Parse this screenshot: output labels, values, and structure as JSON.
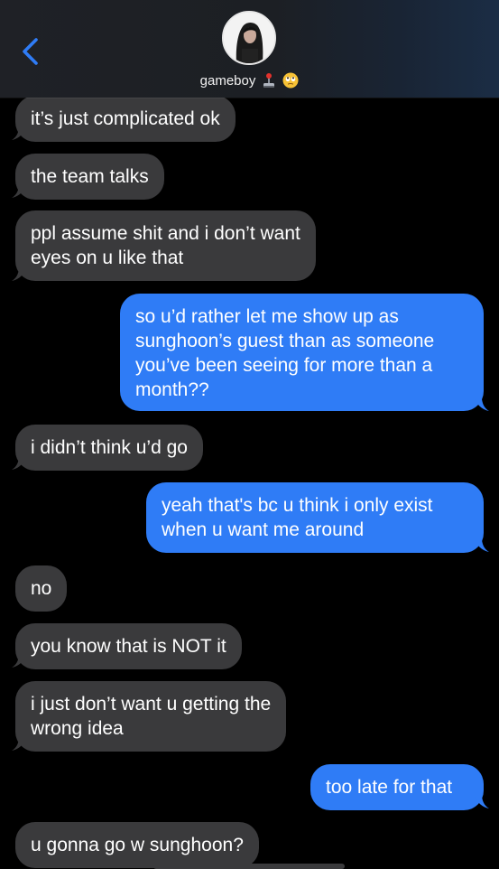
{
  "header": {
    "contact_name": "gameboy",
    "contact_emoji_1": "joystick-icon",
    "contact_emoji_2": "eye-roll-emoji-icon",
    "back_icon": "chevron-left-icon",
    "accent_color": "#2f7cf6"
  },
  "messages": [
    {
      "direction": "incoming",
      "text": "it’s just complicated ok"
    },
    {
      "direction": "incoming",
      "text": "the team talks"
    },
    {
      "direction": "incoming",
      "lines": [
        "ppl assume shit and i don’t want",
        "eyes on u like that"
      ]
    },
    {
      "direction": "outgoing",
      "lines": [
        "so u’d rather let me show up as",
        "sunghoon’s guest than as someone",
        "you’ve been seeing for more than a",
        "month??"
      ]
    },
    {
      "direction": "incoming",
      "text": "i didn’t think u’d go"
    },
    {
      "direction": "outgoing",
      "lines": [
        "yeah that's bc u think i only exist",
        "when u want me around"
      ]
    },
    {
      "direction": "incoming",
      "text": "no"
    },
    {
      "direction": "incoming",
      "text": "you know that is NOT it"
    },
    {
      "direction": "incoming",
      "lines": [
        "i just don’t want u getting the",
        "wrong idea"
      ]
    },
    {
      "direction": "outgoing",
      "text": "too late for that"
    },
    {
      "direction": "incoming",
      "text": "u gonna go w sunghoon?"
    }
  ],
  "colors": {
    "incoming_bubble": "#3a3a3c",
    "outgoing_bubble": "#2f7cf6",
    "background": "#000000"
  }
}
